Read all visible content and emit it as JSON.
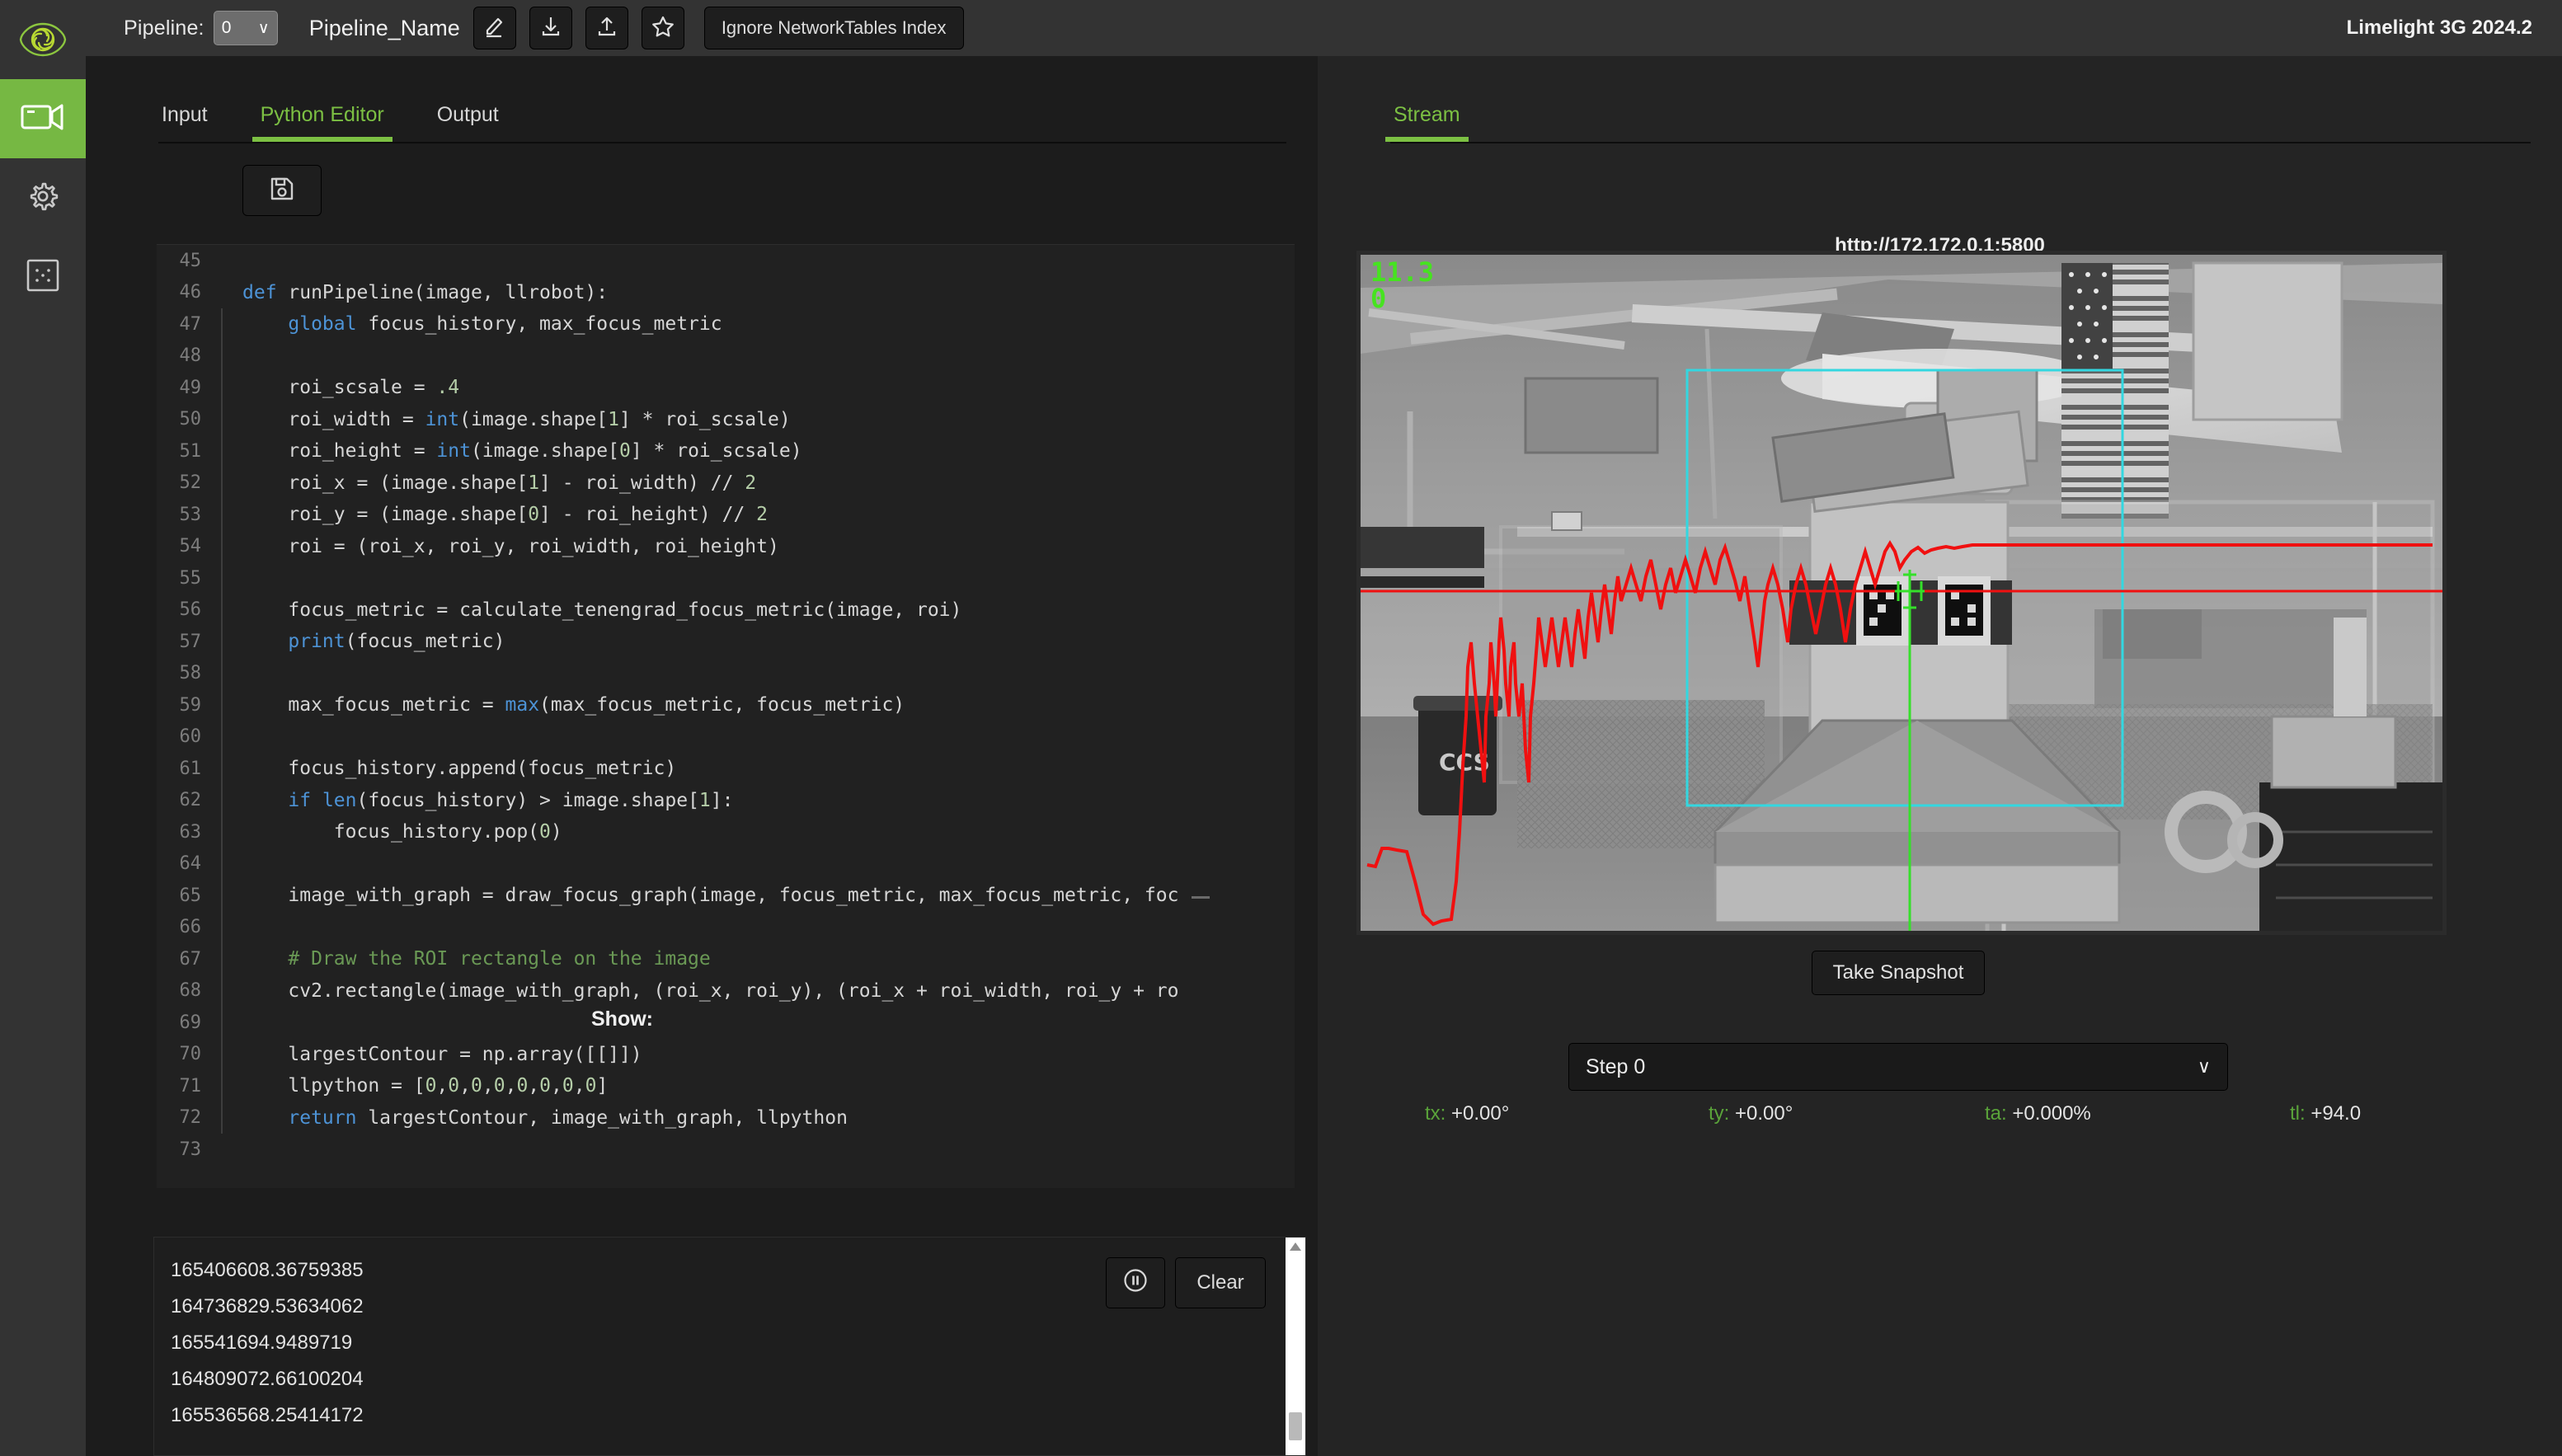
{
  "app": {
    "version": "Limelight 3G 2024.2"
  },
  "sidebar": {
    "items": [
      {
        "name": "limelight-logo",
        "icon": "limelight-eye-icon",
        "active": false
      },
      {
        "name": "camera",
        "icon": "camera-icon",
        "active": true
      },
      {
        "name": "settings",
        "icon": "gear-icon",
        "active": false
      },
      {
        "name": "grid",
        "icon": "grid-dots-icon",
        "active": false
      }
    ]
  },
  "toolbar": {
    "pipeline_label": "Pipeline:",
    "pipeline_value": "0",
    "pipeline_caret": "∨",
    "pipeline_name": "Pipeline_Name",
    "buttons": [
      {
        "name": "edit-pipeline-name-button",
        "icon": "pencil-icon"
      },
      {
        "name": "download-pipeline-button",
        "icon": "download-icon"
      },
      {
        "name": "upload-pipeline-button",
        "icon": "upload-icon"
      },
      {
        "name": "favorite-pipeline-button",
        "icon": "star-icon"
      }
    ],
    "ignore_nt_index_label": "Ignore NetworkTables Index"
  },
  "left_panel": {
    "tabs": [
      {
        "label": "Input",
        "active": false
      },
      {
        "label": "Python Editor",
        "active": true
      },
      {
        "label": "Output",
        "active": false
      }
    ],
    "save_button_icon": "save-floppy-icon"
  },
  "editor": {
    "first_line_number": 45,
    "lines": [
      {
        "n": 45,
        "indent": 0,
        "text": ""
      },
      {
        "n": 46,
        "indent": 0,
        "text": "def runPipeline(image, llrobot):"
      },
      {
        "n": 47,
        "indent": 1,
        "text": "    global focus_history, max_focus_metric"
      },
      {
        "n": 48,
        "indent": 1,
        "text": ""
      },
      {
        "n": 49,
        "indent": 1,
        "text": "    roi_scsale = .4"
      },
      {
        "n": 50,
        "indent": 1,
        "text": "    roi_width = int(image.shape[1] * roi_scsale)"
      },
      {
        "n": 51,
        "indent": 1,
        "text": "    roi_height = int(image.shape[0] * roi_scsale)"
      },
      {
        "n": 52,
        "indent": 1,
        "text": "    roi_x = (image.shape[1] - roi_width) // 2"
      },
      {
        "n": 53,
        "indent": 1,
        "text": "    roi_y = (image.shape[0] - roi_height) // 2"
      },
      {
        "n": 54,
        "indent": 1,
        "text": "    roi = (roi_x, roi_y, roi_width, roi_height)"
      },
      {
        "n": 55,
        "indent": 1,
        "text": ""
      },
      {
        "n": 56,
        "indent": 1,
        "text": "    focus_metric = calculate_tenengrad_focus_metric(image, roi)"
      },
      {
        "n": 57,
        "indent": 1,
        "text": "    print(focus_metric)"
      },
      {
        "n": 58,
        "indent": 1,
        "text": ""
      },
      {
        "n": 59,
        "indent": 1,
        "text": "    max_focus_metric = max(max_focus_metric, focus_metric)"
      },
      {
        "n": 60,
        "indent": 1,
        "text": ""
      },
      {
        "n": 61,
        "indent": 1,
        "text": "    focus_history.append(focus_metric)"
      },
      {
        "n": 62,
        "indent": 1,
        "text": "    if len(focus_history) > image.shape[1]:"
      },
      {
        "n": 63,
        "indent": 2,
        "text": "        focus_history.pop(0)"
      },
      {
        "n": 64,
        "indent": 1,
        "text": ""
      },
      {
        "n": 65,
        "indent": 1,
        "text": "    image_with_graph = draw_focus_graph(image, focus_metric, max_focus_metric, foc"
      },
      {
        "n": 66,
        "indent": 1,
        "text": ""
      },
      {
        "n": 67,
        "indent": 1,
        "text": "    # Draw the ROI rectangle on the image"
      },
      {
        "n": 68,
        "indent": 1,
        "text": "    cv2.rectangle(image_with_graph, (roi_x, roi_y), (roi_x + roi_width, roi_y + ro"
      },
      {
        "n": 69,
        "indent": 1,
        "text": ""
      },
      {
        "n": 70,
        "indent": 1,
        "text": "    largestContour = np.array([[]])"
      },
      {
        "n": 71,
        "indent": 1,
        "text": "    llpython = [0,0,0,0,0,0,0,0]"
      },
      {
        "n": 72,
        "indent": 1,
        "text": "    return largestContour, image_with_graph, llpython"
      },
      {
        "n": 73,
        "indent": 0,
        "text": ""
      }
    ]
  },
  "console": {
    "lines": [
      "165406608.36759385",
      "164736829.53634062",
      "165541694.9489719",
      "164809072.66100204",
      "165536568.25414172"
    ],
    "pause_button_icon": "pause-circle-icon",
    "clear_button_label": "Clear"
  },
  "right_panel": {
    "tabs": [
      {
        "label": "Stream",
        "active": true
      }
    ],
    "stream_url": "http://172.172.0.1:5800",
    "stream_overlay": {
      "fps": "11.3",
      "count": "0"
    },
    "take_snapshot_label": "Take Snapshot",
    "show_label": "Show:",
    "show_value": "Step 0",
    "show_caret": "∨",
    "targeting": [
      {
        "key": "tx:",
        "value": "+0.00°"
      },
      {
        "key": "ty:",
        "value": "+0.00°"
      },
      {
        "key": "ta:",
        "value": "+0.000%"
      },
      {
        "key": "tl:",
        "value": "+94.0"
      }
    ]
  },
  "colors": {
    "accent_green": "#7cc043",
    "bar_bg": "#333333",
    "panel_bg": "#1c1c1c",
    "editor_bg": "#212121",
    "overlay_green": "#46e320",
    "roi_cyan": "#33d7e0",
    "graph_red": "#f01010"
  }
}
